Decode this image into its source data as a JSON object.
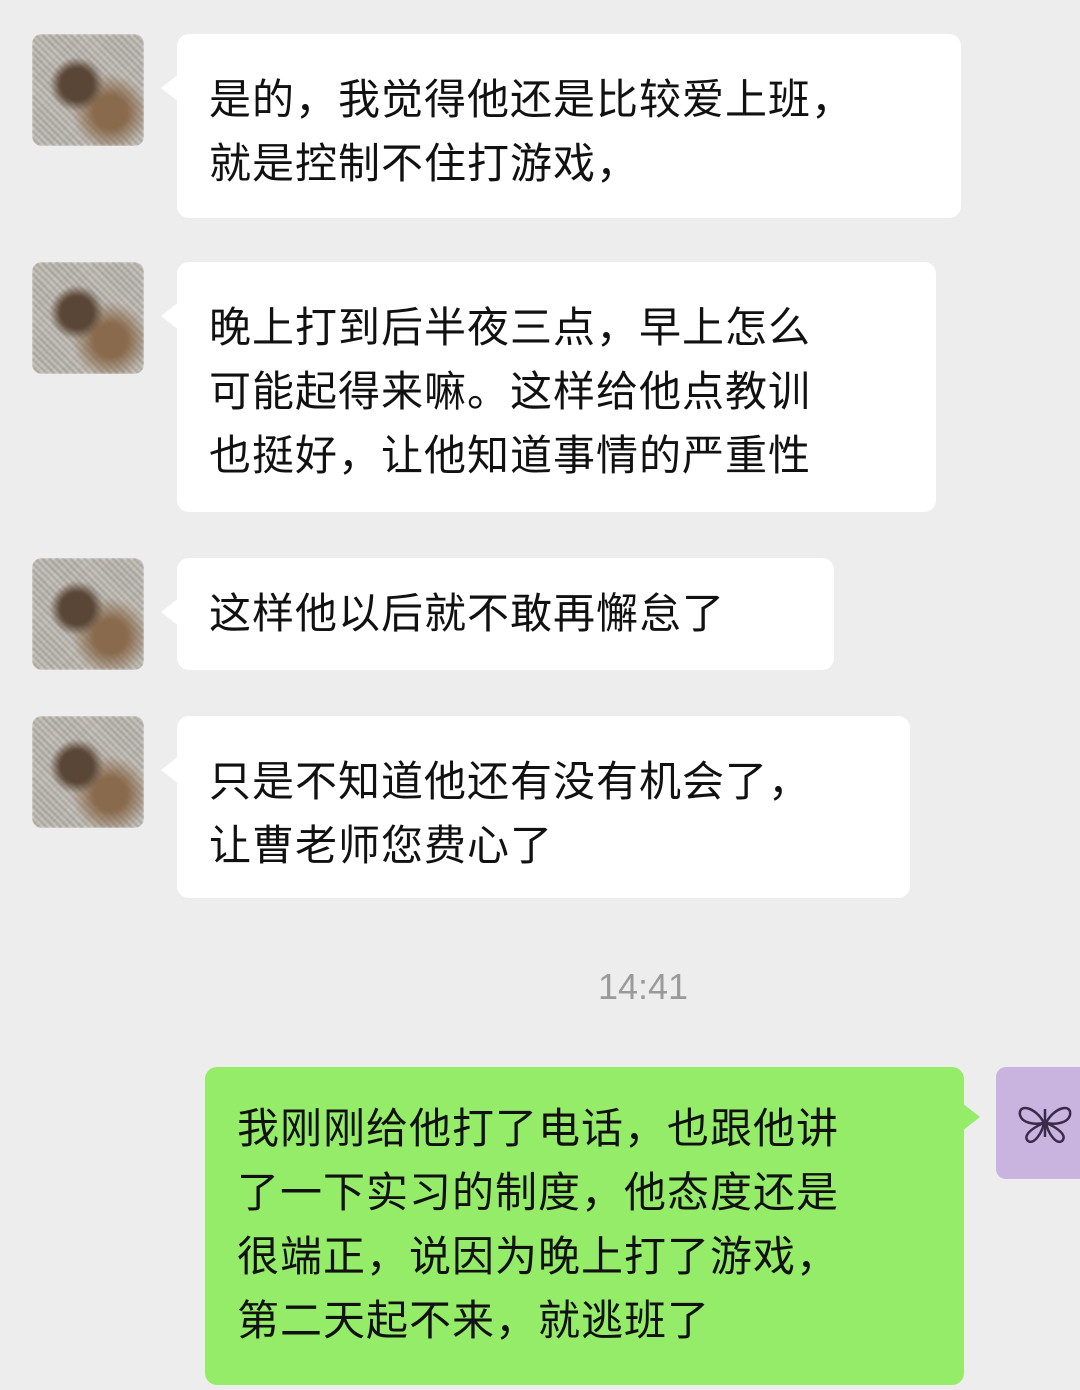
{
  "messages": [
    {
      "lines": [
        "是的，我觉得他还是比较爱上班，",
        "就是控制不住打游戏，"
      ]
    },
    {
      "lines": [
        "晚上打到后半夜三点，早上怎么",
        "可能起得来嘛。这样给他点教训",
        "也挺好，让他知道事情的严重性"
      ]
    },
    {
      "lines": [
        "这样他以后就不敢再懈怠了"
      ]
    },
    {
      "lines": [
        "只是不知道他还有没有机会了，",
        "让曹老师您费心了"
      ]
    }
  ],
  "timestamp": "14:41",
  "reply": {
    "lines": [
      "我刚刚给他打了电话，也跟他讲",
      "了一下实习的制度，他态度还是",
      "很端正，说因为晚上打了游戏，",
      "第二天起不来，就逃班了"
    ]
  },
  "colors": {
    "background": "#ededed",
    "incoming_bubble": "#ffffff",
    "outgoing_bubble": "#95ec69",
    "self_avatar": "#c9b4e0"
  }
}
